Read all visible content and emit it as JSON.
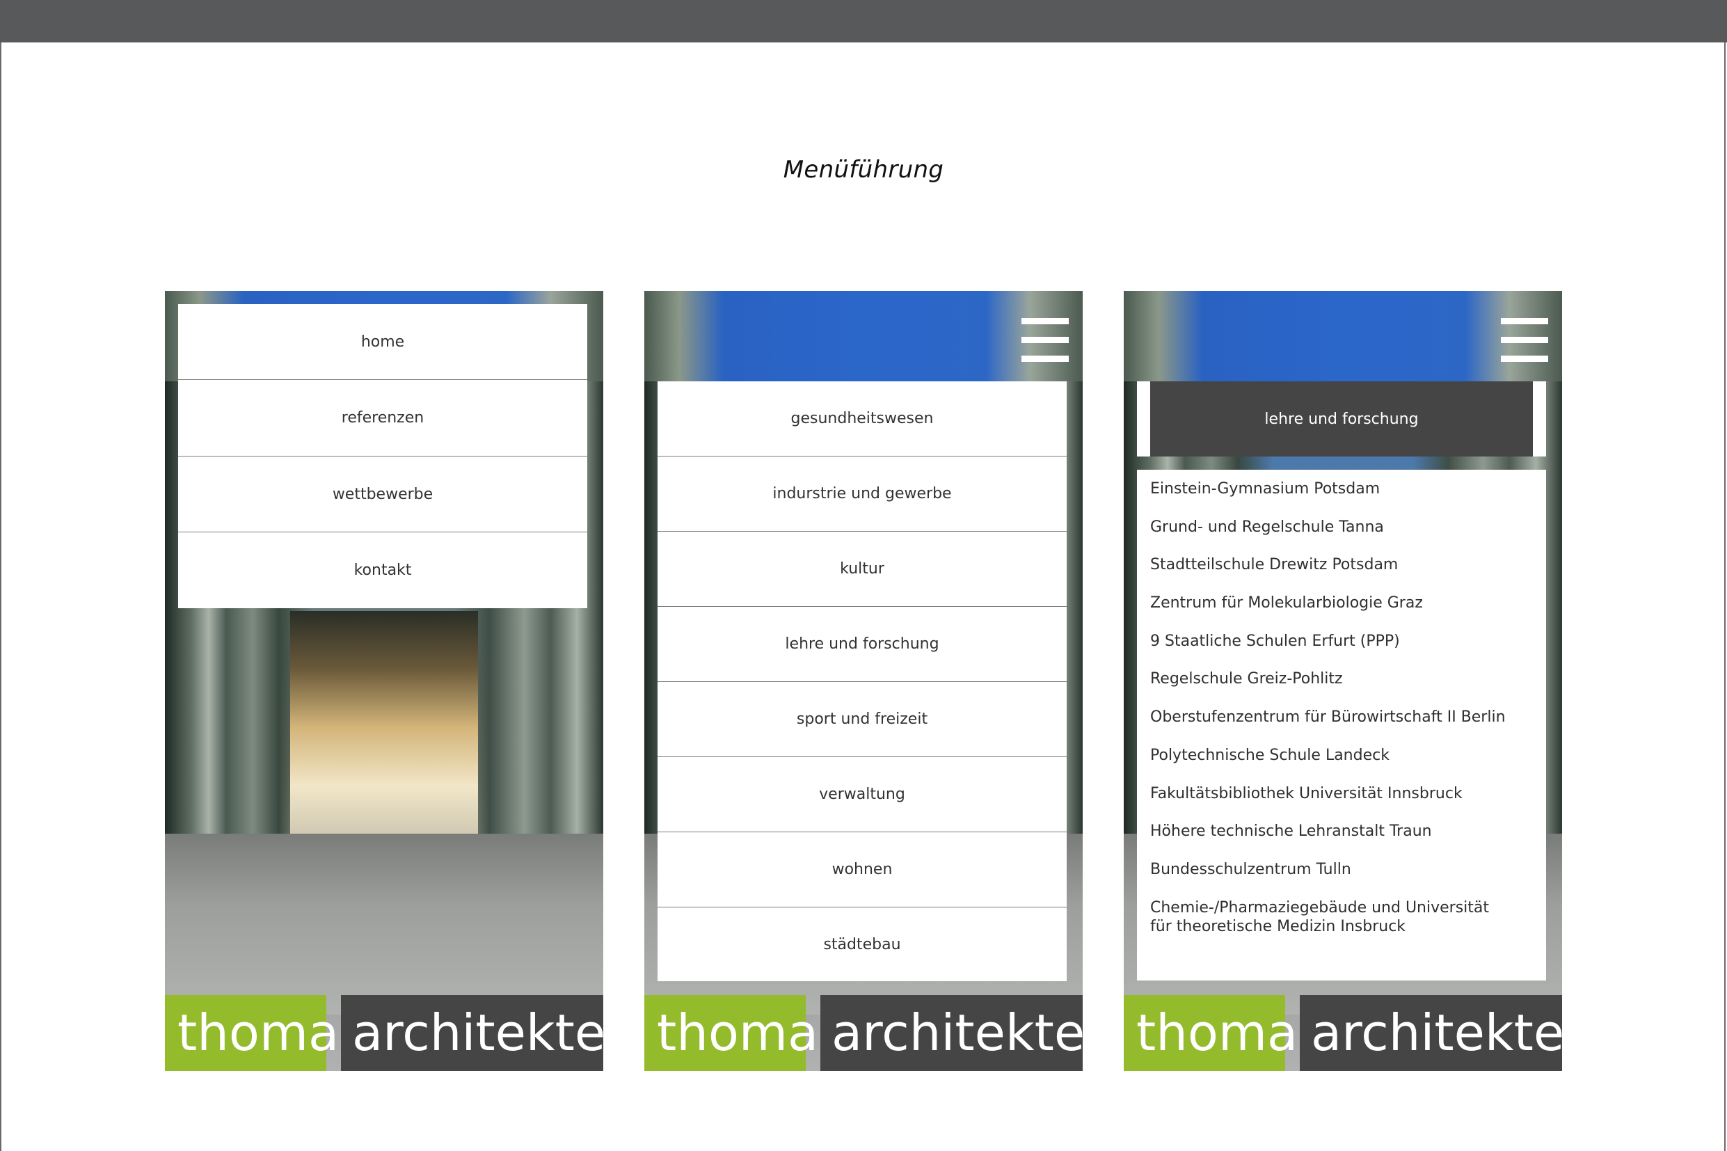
{
  "page": {
    "title": "Menüführung"
  },
  "logo": {
    "part1": "thoma",
    "part2": "architekten"
  },
  "screen1": {
    "menu": [
      "home",
      "referenzen",
      "wettbewerbe",
      "kontakt"
    ]
  },
  "screen2": {
    "menu": [
      "gesundheitswesen",
      "indurstrie und gewerbe",
      "kultur",
      "lehre und forschung",
      "sport und freizeit",
      "verwaltung",
      "wohnen",
      "städtebau"
    ]
  },
  "screen3": {
    "selected": "lehre und forschung",
    "projects": [
      "Einstein-Gymnasium Potsdam",
      "Grund- und Regelschule Tanna",
      "Stadtteilschule Drewitz Potsdam",
      "Zentrum für Molekularbiologie Graz",
      "9 Staatliche Schulen Erfurt (PPP)",
      "Regelschule Greiz-Pohlitz",
      "Oberstufenzentrum für Bürowirtschaft II Berlin",
      "Polytechnische Schule Landeck",
      "Fakultätsbibliothek Universität Innsbruck",
      "Höhere technische Lehranstalt Traun",
      "Bundesschulzentrum Tulln",
      "Chemie-/Pharmaziegebäude und Universität für theoretische Medizin Insbruck"
    ]
  },
  "colors": {
    "brand_green": "#93bb2b",
    "brand_dark": "#454545",
    "topbar": "#58595b"
  }
}
